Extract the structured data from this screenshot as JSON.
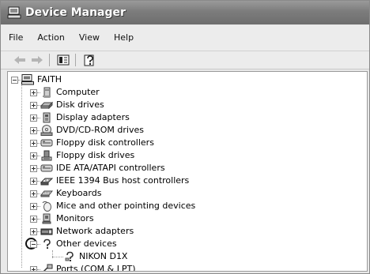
{
  "window": {
    "title": "Device Manager"
  },
  "menu": [
    "File",
    "Action",
    "View",
    "Help"
  ],
  "toolbar": {
    "buttons": [
      "back-arrow-icon",
      "forward-arrow-icon",
      "properties-icon",
      "help-icon"
    ]
  },
  "tree": {
    "root": "FAITH",
    "items": [
      {
        "label": "Computer",
        "icon": "computer-icon"
      },
      {
        "label": "Disk drives",
        "icon": "disk-drive-icon"
      },
      {
        "label": "Display adapters",
        "icon": "display-adapter-icon"
      },
      {
        "label": "DVD/CD-ROM drives",
        "icon": "dvd-drive-icon"
      },
      {
        "label": "Floppy disk controllers",
        "icon": "floppy-controller-icon"
      },
      {
        "label": "Floppy disk drives",
        "icon": "floppy-drive-icon"
      },
      {
        "label": "IDE ATA/ATAPI controllers",
        "icon": "ide-controller-icon"
      },
      {
        "label": "IEEE 1394 Bus host controllers",
        "icon": "ieee1394-icon"
      },
      {
        "label": "Keyboards",
        "icon": "keyboard-icon"
      },
      {
        "label": "Mice and other pointing devices",
        "icon": "mouse-icon"
      },
      {
        "label": "Monitors",
        "icon": "monitor-icon"
      },
      {
        "label": "Network adapters",
        "icon": "network-adapter-icon"
      },
      {
        "label": "Other devices",
        "icon": "unknown-device-icon",
        "expanded": true
      },
      {
        "label": "NIKON D1X",
        "icon": "unknown-device-icon",
        "child": true
      },
      {
        "label": "Ports (COM & LPT)",
        "icon": "port-icon"
      }
    ]
  }
}
